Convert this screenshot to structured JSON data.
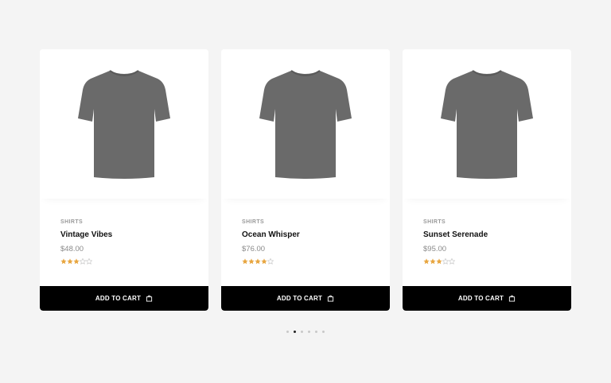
{
  "products": [
    {
      "category": "SHIRTS",
      "name": "Vintage Vibes",
      "price": "$48.00",
      "rating": 3,
      "button_label": "ADD TO CART"
    },
    {
      "category": "SHIRTS",
      "name": "Ocean Whisper",
      "price": "$76.00",
      "rating": 4,
      "button_label": "ADD TO CART"
    },
    {
      "category": "SHIRTS",
      "name": "Sunset Serenade",
      "price": "$95.00",
      "rating": 3,
      "button_label": "ADD TO CART"
    }
  ],
  "rating_max": 5,
  "pagination": {
    "total": 6,
    "active_index": 1
  },
  "colors": {
    "star_filled": "#e8a640",
    "star_empty": "#c9c9c9",
    "button_bg": "#000000",
    "tshirt": "#6a6a6a"
  },
  "icons": {
    "product_image": "tshirt-icon",
    "button_icon": "shopping-bag-icon",
    "rating": "star-icon"
  }
}
